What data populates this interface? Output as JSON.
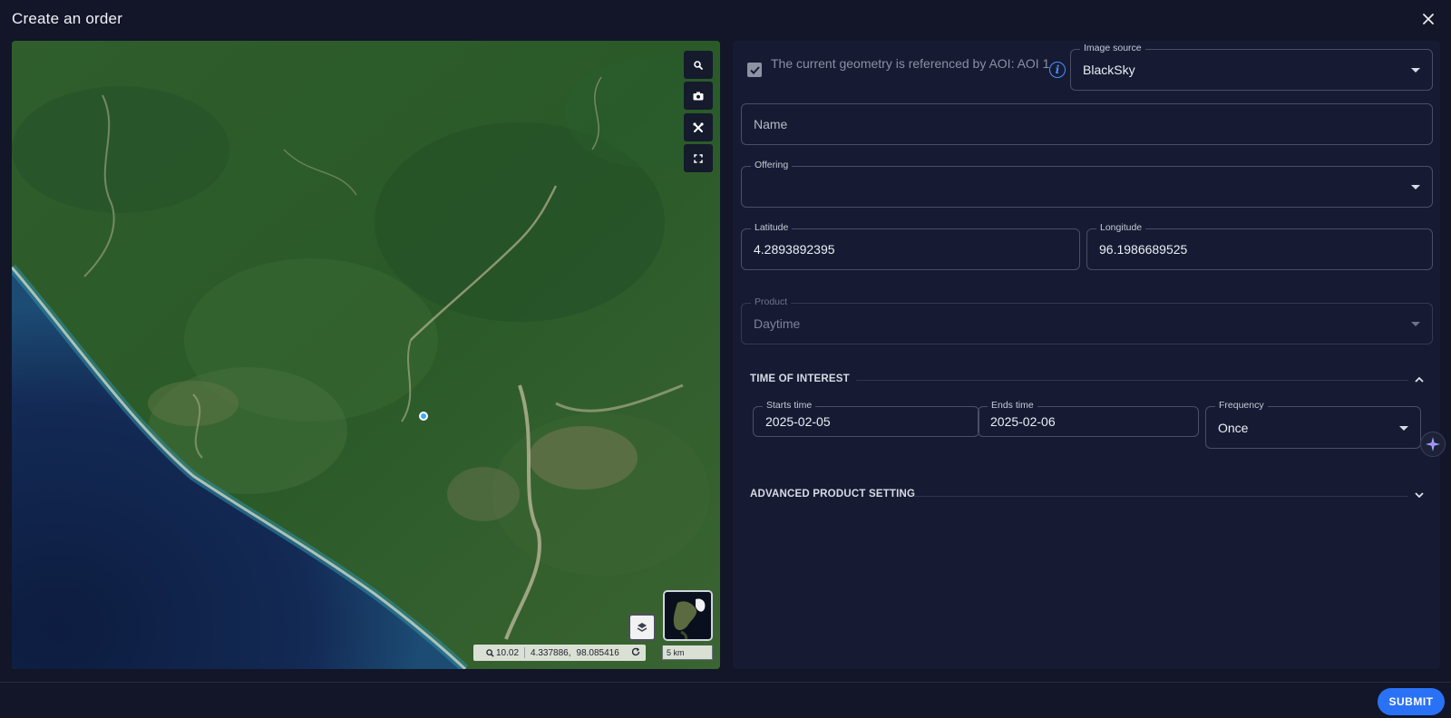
{
  "dialog": {
    "title": "Create an order",
    "close_icon": "close-icon"
  },
  "map": {
    "tools": [
      {
        "name": "map-search-button",
        "icon": "search-icon"
      },
      {
        "name": "map-screenshot-button",
        "icon": "camera-icon"
      },
      {
        "name": "map-draw-tools-button",
        "icon": "tools-icon"
      },
      {
        "name": "map-fullscreen-button",
        "icon": "fullscreen-icon"
      }
    ],
    "zoom_level": "10.02",
    "latitude": "4.337886,",
    "longitude": "98.085416",
    "scale_label": "5 km"
  },
  "form": {
    "aoi_notice": "The current geometry is referenced by AOI: AOI 1",
    "image_source": {
      "label": "Image source",
      "value": "BlackSky"
    },
    "name": {
      "placeholder": "Name"
    },
    "offering": {
      "label": "Offering",
      "value": ""
    },
    "latitude": {
      "label": "Latitude",
      "value": "4.2893892395"
    },
    "longitude": {
      "label": "Longitude",
      "value": "96.1986689525"
    },
    "product": {
      "label": "Product",
      "value": "Daytime"
    },
    "time_of_interest": {
      "title": "TIME OF INTEREST",
      "starts": {
        "label": "Starts time",
        "value": "2025-02-05"
      },
      "ends": {
        "label": "Ends time",
        "value": "2025-02-06"
      },
      "frequency": {
        "label": "Frequency",
        "value": "Once"
      }
    },
    "advanced": {
      "title": "ADVANCED PRODUCT SETTING"
    }
  },
  "footer": {
    "submit_label": "SUBMIT"
  },
  "colors": {
    "background": "#121628",
    "panel": "#161b33",
    "accent": "#2a72f5",
    "field_border": "#4a4f66"
  }
}
